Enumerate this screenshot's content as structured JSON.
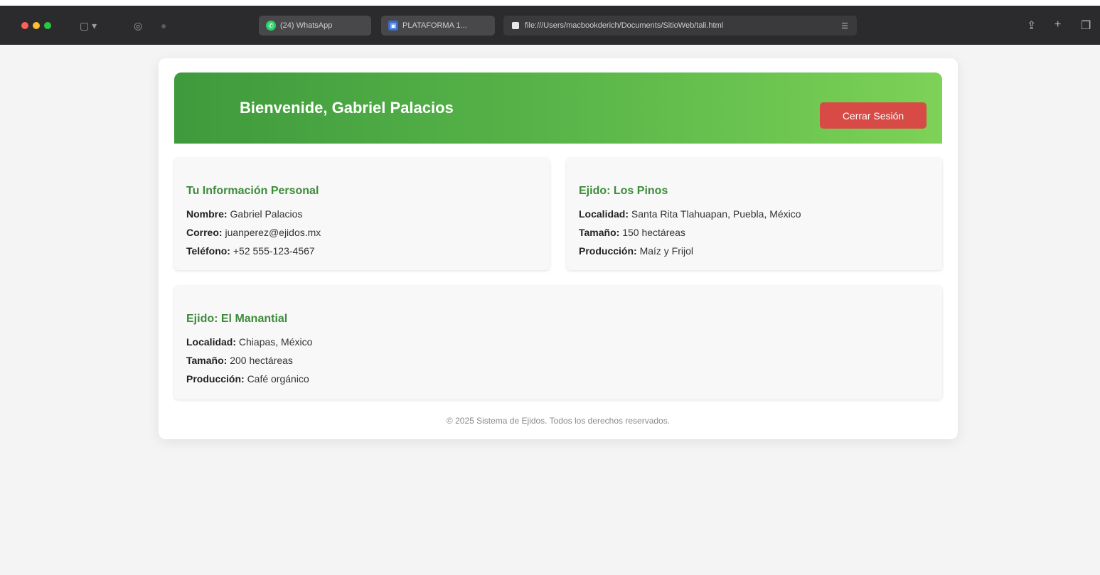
{
  "browser": {
    "tabs": [
      {
        "label": "(24) WhatsApp"
      },
      {
        "label": "PLATAFORMA 1..."
      }
    ],
    "url": "file:///Users/macbookderich/Documents/SitioWeb/tali.html"
  },
  "header": {
    "title": "Bienvenide, Gabriel Palacios",
    "logout_label": "Cerrar Sesión"
  },
  "personal": {
    "title": "Tu Información Personal",
    "rows": [
      {
        "label": "Nombre:",
        "value": "Gabriel Palacios"
      },
      {
        "label": "Correo:",
        "value": "juanperez@ejidos.mx"
      },
      {
        "label": "Teléfono:",
        "value": "+52 555-123-4567"
      }
    ]
  },
  "ejidos": [
    {
      "title": "Ejido: Los Pinos",
      "rows": [
        {
          "label": "Localidad:",
          "value": "Santa Rita Tlahuapan, Puebla, México"
        },
        {
          "label": "Tamaño:",
          "value": "150 hectáreas"
        },
        {
          "label": "Producción:",
          "value": "Maíz y Frijol"
        }
      ]
    },
    {
      "title": "Ejido: El Manantial",
      "rows": [
        {
          "label": "Localidad:",
          "value": "Chiapas, México"
        },
        {
          "label": "Tamaño:",
          "value": "200 hectáreas"
        },
        {
          "label": "Producción:",
          "value": "Café orgánico"
        }
      ]
    }
  ],
  "footer": {
    "text": "© 2025 Sistema de Ejidos. Todos los derechos reservados."
  },
  "colors": {
    "header_start": "#3e9a3c",
    "header_end": "#7dd257",
    "logout_button": "#d84a45",
    "section_title": "#3d8c3a"
  }
}
